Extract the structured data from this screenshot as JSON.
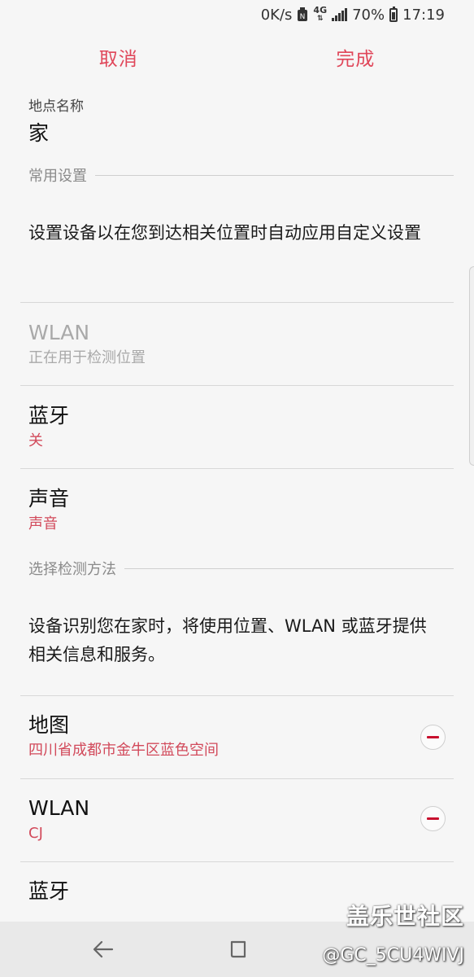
{
  "status_bar": {
    "speed": "0K/s",
    "network": "4G",
    "battery": "70%",
    "time": "17:19"
  },
  "action_bar": {
    "cancel": "取消",
    "done": "完成"
  },
  "place": {
    "label": "地点名称",
    "value": "家"
  },
  "common_settings": {
    "header": "常用设置",
    "description": "设置设备以在您到达相关位置时自动应用自定义设置",
    "items": [
      {
        "title": "WLAN",
        "subtitle": "正在用于检测位置"
      },
      {
        "title": "蓝牙",
        "subtitle": "关"
      },
      {
        "title": "声音",
        "subtitle": "声音"
      }
    ]
  },
  "detection": {
    "header": "选择检测方法",
    "description": "设备识别您在家时，将使用位置、WLAN 或蓝牙提供相关信息和服务。",
    "items": [
      {
        "title": "地图",
        "subtitle": "四川省成都市金牛区蓝色空间"
      },
      {
        "title": "WLAN",
        "subtitle": "CJ"
      },
      {
        "title": "蓝牙"
      }
    ]
  },
  "watermark": {
    "site": "盖乐世社区",
    "user": "@GC_5CU4WIVJ"
  },
  "colors": {
    "accent": "#e0475a",
    "subtitle_red": "#d24a5b",
    "minus_red": "#c8102e",
    "background": "#f6f6f6"
  }
}
